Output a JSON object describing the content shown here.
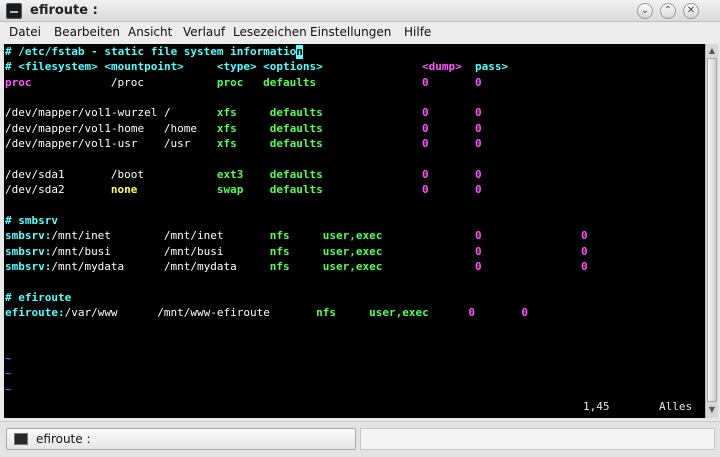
{
  "window": {
    "title": "efiroute :"
  },
  "menu": [
    "Datei",
    "Bearbeiten",
    "Ansicht",
    "Verlauf",
    "Lesezeichen",
    "Einstellungen",
    "Hilfe"
  ],
  "terminal": {
    "lines": [
      {
        "segments": [
          {
            "text": "# /etc/fstab - static file system informatio",
            "cls": "c-cyan bold",
            "col": 0
          },
          {
            "text": "n",
            "cls": "cursor bold",
            "col": 44
          }
        ]
      },
      {
        "segments": [
          {
            "text": "# <filesystem> <mountpoint>",
            "cls": "c-cyan bold",
            "col": 0
          },
          {
            "text": "<type> <options>",
            "cls": "c-cyan bold",
            "col": 32
          },
          {
            "text": "<dump>",
            "cls": "c-mag bold",
            "col": 63
          },
          {
            "text": "pass>",
            "cls": "c-cyan bold",
            "col": 71
          }
        ]
      },
      {
        "segments": [
          {
            "text": "proc",
            "cls": "c-mag bold",
            "col": 0
          },
          {
            "text": "/proc",
            "cls": "c-white",
            "col": 16
          },
          {
            "text": "proc",
            "cls": "c-green bold",
            "col": 32
          },
          {
            "text": "defaults",
            "cls": "c-green bold",
            "col": 39
          },
          {
            "text": "0",
            "cls": "c-mag bold",
            "col": 63
          },
          {
            "text": "0",
            "cls": "c-mag bold",
            "col": 71
          }
        ]
      },
      {
        "segments": []
      },
      {
        "segments": [
          {
            "text": "/dev/mapper/vol1-wurzel /",
            "cls": "c-white",
            "col": 0
          },
          {
            "text": "xfs",
            "cls": "c-green bold",
            "col": 32
          },
          {
            "text": "defaults",
            "cls": "c-green bold",
            "col": 40
          },
          {
            "text": "0",
            "cls": "c-mag bold",
            "col": 63
          },
          {
            "text": "0",
            "cls": "c-mag bold",
            "col": 71
          }
        ]
      },
      {
        "segments": [
          {
            "text": "/dev/mapper/vol1-home",
            "cls": "c-white",
            "col": 0
          },
          {
            "text": "/home",
            "cls": "c-white",
            "col": 24
          },
          {
            "text": "xfs",
            "cls": "c-green bold",
            "col": 32
          },
          {
            "text": "defaults",
            "cls": "c-green bold",
            "col": 40
          },
          {
            "text": "0",
            "cls": "c-mag bold",
            "col": 63
          },
          {
            "text": "0",
            "cls": "c-mag bold",
            "col": 71
          }
        ]
      },
      {
        "segments": [
          {
            "text": "/dev/mapper/vol1-usr",
            "cls": "c-white",
            "col": 0
          },
          {
            "text": "/usr",
            "cls": "c-white",
            "col": 24
          },
          {
            "text": "xfs",
            "cls": "c-green bold",
            "col": 32
          },
          {
            "text": "defaults",
            "cls": "c-green bold",
            "col": 40
          },
          {
            "text": "0",
            "cls": "c-mag bold",
            "col": 63
          },
          {
            "text": "0",
            "cls": "c-mag bold",
            "col": 71
          }
        ]
      },
      {
        "segments": []
      },
      {
        "segments": [
          {
            "text": "/dev/sda1",
            "cls": "c-white",
            "col": 0
          },
          {
            "text": "/boot",
            "cls": "c-white",
            "col": 16
          },
          {
            "text": "ext3",
            "cls": "c-green bold",
            "col": 32
          },
          {
            "text": "defaults",
            "cls": "c-green bold",
            "col": 40
          },
          {
            "text": "0",
            "cls": "c-mag bold",
            "col": 63
          },
          {
            "text": "0",
            "cls": "c-mag bold",
            "col": 71
          }
        ]
      },
      {
        "segments": [
          {
            "text": "/dev/sda2",
            "cls": "c-white",
            "col": 0
          },
          {
            "text": "none",
            "cls": "c-yellow bold",
            "col": 16
          },
          {
            "text": "swap",
            "cls": "c-green bold",
            "col": 32
          },
          {
            "text": "defaults",
            "cls": "c-green bold",
            "col": 40
          },
          {
            "text": "0",
            "cls": "c-mag bold",
            "col": 63
          },
          {
            "text": "0",
            "cls": "c-mag bold",
            "col": 71
          }
        ]
      },
      {
        "segments": []
      },
      {
        "segments": [
          {
            "text": "# smbsrv",
            "cls": "c-cyan bold",
            "col": 0
          }
        ]
      },
      {
        "segments": [
          {
            "text": "smbsrv:",
            "cls": "c-cyan bold",
            "col": 0
          },
          {
            "text": "/mnt/inet",
            "cls": "c-white",
            "col": 7
          },
          {
            "text": "/mnt/inet",
            "cls": "c-white",
            "col": 24
          },
          {
            "text": "nfs",
            "cls": "c-green bold",
            "col": 40
          },
          {
            "text": "user,exec",
            "cls": "c-green bold",
            "col": 48
          },
          {
            "text": "0",
            "cls": "c-mag bold",
            "col": 71
          },
          {
            "text": "0",
            "cls": "c-mag bold",
            "col": 87
          }
        ]
      },
      {
        "segments": [
          {
            "text": "smbsrv:",
            "cls": "c-cyan bold",
            "col": 0
          },
          {
            "text": "/mnt/busi",
            "cls": "c-white",
            "col": 7
          },
          {
            "text": "/mnt/busi",
            "cls": "c-white",
            "col": 24
          },
          {
            "text": "nfs",
            "cls": "c-green bold",
            "col": 40
          },
          {
            "text": "user,exec",
            "cls": "c-green bold",
            "col": 48
          },
          {
            "text": "0",
            "cls": "c-mag bold",
            "col": 71
          },
          {
            "text": "0",
            "cls": "c-mag bold",
            "col": 87
          }
        ]
      },
      {
        "segments": [
          {
            "text": "smbsrv:",
            "cls": "c-cyan bold",
            "col": 0
          },
          {
            "text": "/mnt/mydata",
            "cls": "c-white",
            "col": 7
          },
          {
            "text": "/mnt/mydata",
            "cls": "c-white",
            "col": 24
          },
          {
            "text": "nfs",
            "cls": "c-green bold",
            "col": 40
          },
          {
            "text": "user,exec",
            "cls": "c-green bold",
            "col": 48
          },
          {
            "text": "0",
            "cls": "c-mag bold",
            "col": 71
          },
          {
            "text": "0",
            "cls": "c-mag bold",
            "col": 87
          }
        ]
      },
      {
        "segments": []
      },
      {
        "segments": [
          {
            "text": "# efiroute",
            "cls": "c-cyan bold",
            "col": 0
          }
        ]
      },
      {
        "segments": [
          {
            "text": "efiroute:",
            "cls": "c-cyan bold",
            "col": 0
          },
          {
            "text": "/var/www",
            "cls": "c-white",
            "col": 9
          },
          {
            "text": "/mnt/www-efiroute",
            "cls": "c-white",
            "col": 23
          },
          {
            "text": "nfs",
            "cls": "c-green bold",
            "col": 47
          },
          {
            "text": "user,exec",
            "cls": "c-green bold",
            "col": 55
          },
          {
            "text": "0",
            "cls": "c-mag bold",
            "col": 70
          },
          {
            "text": "0",
            "cls": "c-mag bold",
            "col": 78
          }
        ]
      },
      {
        "segments": []
      },
      {
        "segments": []
      },
      {
        "segments": [
          {
            "text": "~",
            "cls": "c-blue bold",
            "col": 0
          }
        ]
      },
      {
        "segments": [
          {
            "text": "~",
            "cls": "c-blue bold",
            "col": 0
          }
        ]
      },
      {
        "segments": [
          {
            "text": "~",
            "cls": "c-blue bold",
            "col": 0
          }
        ]
      }
    ],
    "status": {
      "position": "1,45",
      "scroll": "Alles"
    }
  },
  "taskbar": {
    "task_label": "efiroute :"
  }
}
